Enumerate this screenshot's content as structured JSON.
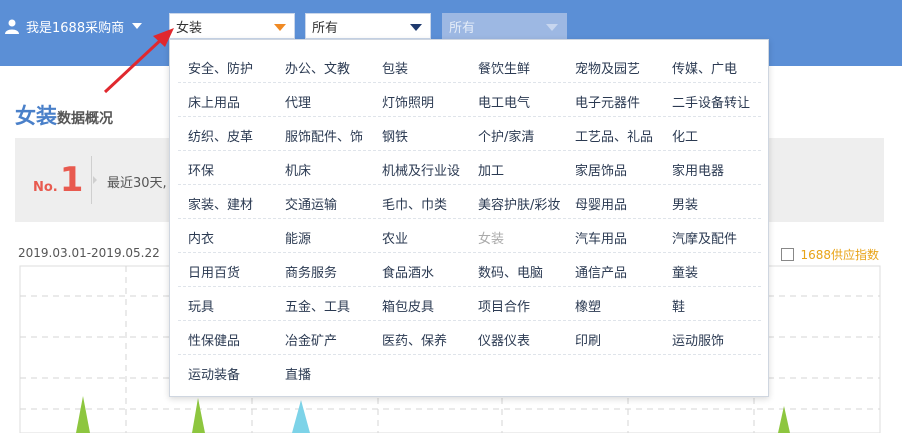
{
  "header": {
    "user_label": "我是1688采购商",
    "selects": [
      {
        "value": "女装"
      },
      {
        "value": "所有"
      },
      {
        "value": "所有"
      }
    ]
  },
  "page_title": {
    "main": "女装",
    "sub": "数据概况"
  },
  "rank": {
    "prefix": "No.",
    "value": "1",
    "text": "最近30天,"
  },
  "chart": {
    "date_range": "2019.03.01-2019.05.22",
    "index_option_label": "1688供应指数"
  },
  "category_dropdown": {
    "selected": "女装",
    "rows": [
      [
        "安全、防护",
        "办公、文教",
        "包装",
        "餐饮生鲜",
        "宠物及园艺",
        "传媒、广电"
      ],
      [
        "床上用品",
        "代理",
        "灯饰照明",
        "电工电气",
        "电子元器件",
        "二手设备转让"
      ],
      [
        "纺织、皮革",
        "服饰配件、饰",
        "钢铁",
        "个护/家清",
        "工艺品、礼品",
        "化工"
      ],
      [
        "环保",
        "机床",
        "机械及行业设",
        "加工",
        "家居饰品",
        "家用电器"
      ],
      [
        "家装、建材",
        "交通运输",
        "毛巾、巾类",
        "美容护肤/彩妆",
        "母婴用品",
        "男装"
      ],
      [
        "内衣",
        "能源",
        "农业",
        "女装",
        "汽车用品",
        "汽摩及配件"
      ],
      [
        "日用百货",
        "商务服务",
        "食品酒水",
        "数码、电脑",
        "通信产品",
        "童装"
      ],
      [
        "玩具",
        "五金、工具",
        "箱包皮具",
        "项目合作",
        "橡塑",
        "鞋"
      ],
      [
        "性保健品",
        "冶金矿产",
        "医药、保养",
        "仪器仪表",
        "印刷",
        "运动服饰"
      ],
      [
        "运动装备",
        "直播"
      ]
    ]
  },
  "colors": {
    "topbar": "#5b8fd6",
    "accent_title": "#4a80c9",
    "rank_red": "#e85a4f",
    "annotation_arrow": "#e0282e",
    "index_label": "#e8a317"
  },
  "icons": {
    "user": "user-icon",
    "caret": "caret-down-icon"
  }
}
